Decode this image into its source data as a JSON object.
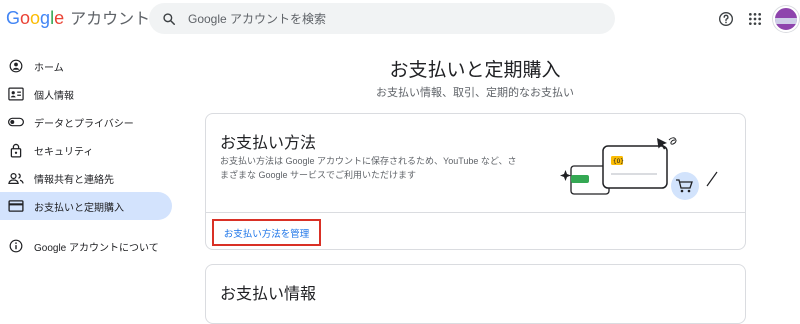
{
  "header": {
    "logo_letters": [
      "G",
      "o",
      "o",
      "g",
      "l",
      "e"
    ],
    "product_name": "アカウント",
    "search_placeholder": "Google アカウントを検索"
  },
  "sidebar": {
    "items": [
      {
        "label": "ホーム",
        "icon": "home-icon"
      },
      {
        "label": "個人情報",
        "icon": "personal-info-icon"
      },
      {
        "label": "データとプライバシー",
        "icon": "toggle-icon"
      },
      {
        "label": "セキュリティ",
        "icon": "lock-icon"
      },
      {
        "label": "情報共有と連絡先",
        "icon": "people-icon"
      },
      {
        "label": "お支払いと定期購入",
        "icon": "credit-card-icon",
        "active": true
      },
      {
        "label": "Google アカウントについて",
        "icon": "info-icon"
      }
    ]
  },
  "main": {
    "title": "お支払いと定期購入",
    "subtitle": "お支払い情報、取引、定期的なお支払い",
    "payment_methods_card": {
      "title": "お支払い方法",
      "description": "お支払い方法は Google アカウントに保存されるため、YouTube など、さまざまな Google サービスでご利用いただけます",
      "manage_link": "お支払い方法を管理"
    },
    "payment_info_card": {
      "title": "お支払い情報"
    }
  },
  "colors": {
    "google_blue": "#4285f4",
    "google_red": "#ea4335",
    "google_yellow": "#fbbc05",
    "google_green": "#34a853",
    "active_nav_bg": "#d3e3fd",
    "link_blue": "#1a73e8",
    "highlight_red": "#d93025"
  }
}
